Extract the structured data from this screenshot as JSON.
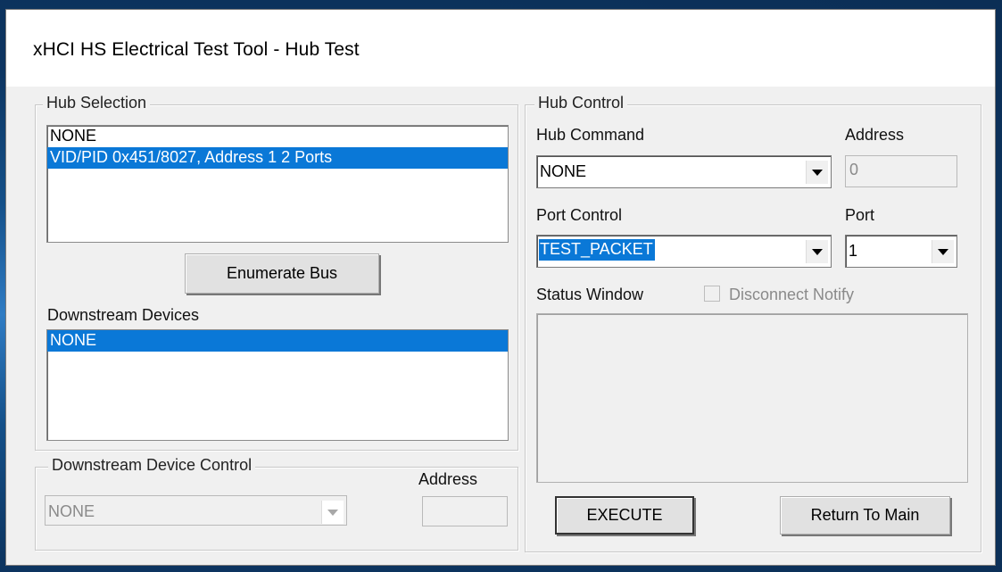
{
  "window": {
    "title": "xHCI HS Electrical Test Tool - Hub Test"
  },
  "hub_selection": {
    "legend": "Hub Selection",
    "items": [
      "NONE",
      "VID/PID 0x451/8027, Address 1  2 Ports"
    ],
    "selected_index": 1,
    "enumerate_label": "Enumerate Bus"
  },
  "downstream_devices": {
    "label": "Downstream Devices",
    "items": [
      "NONE"
    ],
    "selected_index": 0
  },
  "downstream_device_control": {
    "legend": "Downstream Device Control",
    "combo_value": "NONE",
    "address_label": "Address",
    "address_value": ""
  },
  "hub_control": {
    "legend": "Hub Control",
    "hub_command_label": "Hub Command",
    "hub_command_value": "NONE",
    "address_label": "Address",
    "address_value": "0",
    "port_control_label": "Port Control",
    "port_control_value": "TEST_PACKET",
    "port_label": "Port",
    "port_value": "1",
    "status_window_label": "Status Window",
    "disconnect_notify_label": "Disconnect Notify",
    "disconnect_notify_checked": false,
    "status_text": "",
    "execute_label": "EXECUTE",
    "return_label": "Return To Main"
  },
  "colors": {
    "selection": "#0a78d7",
    "desktop": "#0e3a63",
    "dialog": "#f0f0f0"
  }
}
